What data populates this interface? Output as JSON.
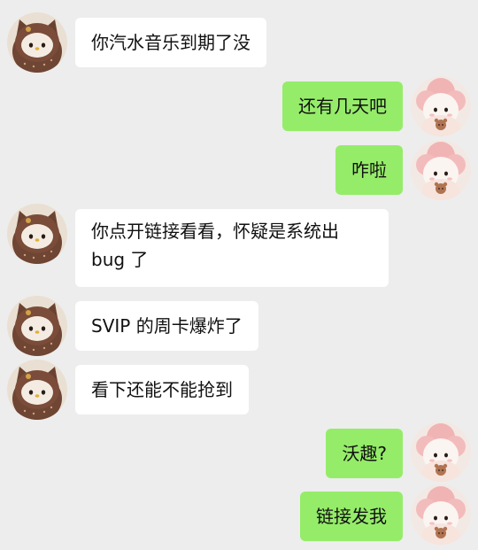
{
  "colors": {
    "background": "#ededed",
    "incoming_bubble": "#ffffff",
    "outgoing_bubble": "#95ec69",
    "text": "#111111"
  },
  "avatars": {
    "contact": "brown-kitty-plush-avatar",
    "self": "pink-lamb-plush-avatar"
  },
  "messages": [
    {
      "sender": "contact",
      "text": "你汽水音乐到期了没"
    },
    {
      "sender": "self",
      "text": "还有几天吧"
    },
    {
      "sender": "self",
      "text": "咋啦"
    },
    {
      "sender": "contact",
      "lines": [
        "你点开链接看看，怀疑是系统出",
        "bug 了"
      ]
    },
    {
      "sender": "contact",
      "text": "SVIP 的周卡爆炸了"
    },
    {
      "sender": "contact",
      "text": "看下还能不能抢到"
    },
    {
      "sender": "self",
      "text": "沃趣?"
    },
    {
      "sender": "self",
      "text": "链接发我"
    }
  ]
}
